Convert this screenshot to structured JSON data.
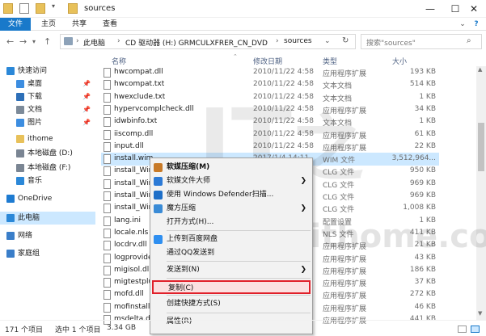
{
  "window": {
    "title": "sources",
    "minimize": "—",
    "maximize": "☐",
    "close": "✕"
  },
  "ribbon": {
    "tabs": [
      "文件",
      "主页",
      "共享",
      "查看"
    ]
  },
  "addressbar": {
    "back": "←",
    "forward": "→",
    "up": "↑",
    "breadcrumbs": [
      "此电脑",
      "CD 驱动器 (H:) GRMCULXFRER_CN_DVD",
      "sources"
    ],
    "search_placeholder": "搜索\"sources\""
  },
  "nav": {
    "items": [
      {
        "label": "快速访问",
        "icon": "star-icon",
        "color": "#2b88d8",
        "indent": 0,
        "pinned": false
      },
      {
        "label": "桌面",
        "icon": "desktop-icon",
        "color": "#3c8de0",
        "indent": 1,
        "pinned": true
      },
      {
        "label": "下载",
        "icon": "download-icon",
        "color": "#2d6fb8",
        "indent": 1,
        "pinned": true
      },
      {
        "label": "文档",
        "icon": "document-icon",
        "color": "#7c8a99",
        "indent": 1,
        "pinned": true
      },
      {
        "label": "图片",
        "icon": "picture-icon",
        "color": "#3c8de0",
        "indent": 1,
        "pinned": true
      },
      {
        "label": "ithome",
        "icon": "folder-icon",
        "color": "#e8c15a",
        "indent": 1,
        "pinned": false
      },
      {
        "label": "本地磁盘 (D:)",
        "icon": "drive-icon",
        "color": "#7a8593",
        "indent": 1,
        "pinned": false
      },
      {
        "label": "本地磁盘 (F:)",
        "icon": "drive-icon",
        "color": "#7a8593",
        "indent": 1,
        "pinned": false
      },
      {
        "label": "音乐",
        "icon": "music-icon",
        "color": "#2b88d8",
        "indent": 1,
        "pinned": false
      },
      {
        "label": "OneDrive",
        "icon": "cloud-icon",
        "color": "#1e7bd1",
        "indent": 0,
        "pinned": false
      },
      {
        "label": "此电脑",
        "icon": "computer-icon",
        "color": "#2b88d8",
        "indent": 0,
        "pinned": false
      },
      {
        "label": "网络",
        "icon": "network-icon",
        "color": "#3a7ec9",
        "indent": 0,
        "pinned": false
      },
      {
        "label": "家庭组",
        "icon": "homegroup-icon",
        "color": "#3a7ec9",
        "indent": 0,
        "pinned": false
      }
    ],
    "pin_glyph": "📌"
  },
  "columns": {
    "name": "名称",
    "date": "修改日期",
    "type": "类型",
    "size": "大小"
  },
  "files": [
    {
      "name": "hwcompat.dll",
      "date": "2010/11/22 4:58",
      "type": "应用程序扩展",
      "size": "193 KB"
    },
    {
      "name": "hwcompat.txt",
      "date": "2010/11/22 4:58",
      "type": "文本文档",
      "size": "514 KB"
    },
    {
      "name": "hwexclude.txt",
      "date": "2010/11/22 4:58",
      "type": "文本文档",
      "size": "1 KB"
    },
    {
      "name": "hypervcomplcheck.dll",
      "date": "2010/11/22 4:58",
      "type": "应用程序扩展",
      "size": "34 KB"
    },
    {
      "name": "idwbinfo.txt",
      "date": "2010/11/22 4:58",
      "type": "文本文档",
      "size": "1 KB"
    },
    {
      "name": "iiscomp.dll",
      "date": "2010/11/22 4:58",
      "type": "应用程序扩展",
      "size": "61 KB"
    },
    {
      "name": "input.dll",
      "date": "2010/11/22 4:58",
      "type": "应用程序扩展",
      "size": "22 KB"
    },
    {
      "name": "install.wim",
      "date": "2017/1/4 14:11",
      "type": "WIM 文件",
      "size": "3,512,964..."
    },
    {
      "name": "install_Windo",
      "date": "",
      "type": "CLG 文件",
      "size": "950 KB"
    },
    {
      "name": "install_Windo",
      "date": "",
      "type": "CLG 文件",
      "size": "969 KB"
    },
    {
      "name": "install_Windo",
      "date": "",
      "type": "CLG 文件",
      "size": "969 KB"
    },
    {
      "name": "install_Windo",
      "date": "",
      "type": "CLG 文件",
      "size": "1,008 KB"
    },
    {
      "name": "lang.ini",
      "date": "",
      "type": "配置设置",
      "size": "1 KB"
    },
    {
      "name": "locale.nls",
      "date": "",
      "type": "NLS 文件",
      "size": "411 KB"
    },
    {
      "name": "locdrv.dll",
      "date": "",
      "type": "应用程序扩展",
      "size": "21 KB"
    },
    {
      "name": "logprovider.d",
      "date": "",
      "type": "应用程序扩展",
      "size": "43 KB"
    },
    {
      "name": "migisol.dll",
      "date": "",
      "type": "应用程序扩展",
      "size": "186 KB"
    },
    {
      "name": "migtestplugin",
      "date": "",
      "type": "应用程序扩展",
      "size": "37 KB"
    },
    {
      "name": "mofd.dll",
      "date": "",
      "type": "应用程序扩展",
      "size": "272 KB"
    },
    {
      "name": "mofinstall.dll",
      "date": "",
      "type": "应用程序扩展",
      "size": "46 KB"
    },
    {
      "name": "msdelta.dll",
      "date": "",
      "type": "应用程序扩展",
      "size": "441 KB"
    }
  ],
  "context_menu": {
    "items": [
      {
        "label": "软媒压缩(M)",
        "icon": "ruanmei-zip-icon",
        "color": "#c87a28",
        "arrow": false,
        "bold": true
      },
      {
        "label": "软媒文件大师",
        "icon": "ruanmei-file-icon",
        "color": "#2c7ad6",
        "arrow": true,
        "bold": false
      },
      {
        "label": "使用 Windows Defender扫描...",
        "icon": "defender-shield-icon",
        "color": "#1e6fc8",
        "arrow": false,
        "bold": false
      },
      {
        "label": "魔方压缩",
        "icon": "mofang-zip-icon",
        "color": "#3a8bd6",
        "arrow": true,
        "bold": false
      },
      {
        "label": "打开方式(H)...",
        "icon": "",
        "color": "",
        "arrow": false,
        "bold": false
      },
      {
        "label": "上传到百度网盘",
        "icon": "baidu-cloud-icon",
        "color": "#2f8ff0",
        "arrow": false,
        "bold": false
      },
      {
        "label": "通过QQ发送到",
        "icon": "",
        "color": "",
        "arrow": false,
        "bold": false
      },
      {
        "label": "发送到(N)",
        "icon": "",
        "color": "",
        "arrow": true,
        "bold": false
      },
      {
        "label": "复制(C)",
        "icon": "",
        "color": "",
        "arrow": false,
        "bold": false
      },
      {
        "label": "创建快捷方式(S)",
        "icon": "",
        "color": "",
        "arrow": false,
        "bold": false
      },
      {
        "label": "属性(R)",
        "icon": "",
        "color": "",
        "arrow": false,
        "bold": false
      }
    ],
    "arrow_glyph": "❯"
  },
  "status": {
    "count": "171 个项目",
    "selected": "选中 1 个项目",
    "size": "3.34 GB"
  },
  "watermark": {
    "text": "www.ithome.com"
  },
  "colors": {
    "accent": "#1979ca",
    "selection": "#cce8ff",
    "highlight_border": "#e0202a"
  }
}
